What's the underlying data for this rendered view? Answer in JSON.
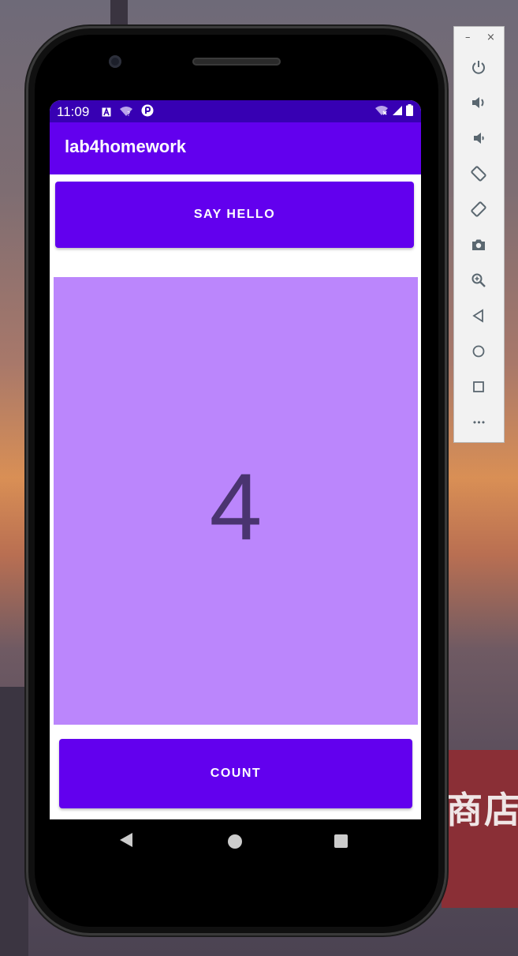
{
  "status_bar": {
    "time": "11:09"
  },
  "app": {
    "title": "lab4homework",
    "say_hello_label": "SAY HELLO",
    "count_value": "4",
    "count_label": "COUNT"
  },
  "toolbar": {
    "minimize": "–",
    "close": "×",
    "more": "•••"
  },
  "background": {
    "sign_text": "商店"
  },
  "colors": {
    "status_bar": "#3700b3",
    "app_bar": "#6200ee",
    "button": "#6200ee",
    "count_panel": "#bb86fc",
    "count_text": "#4a3470"
  }
}
